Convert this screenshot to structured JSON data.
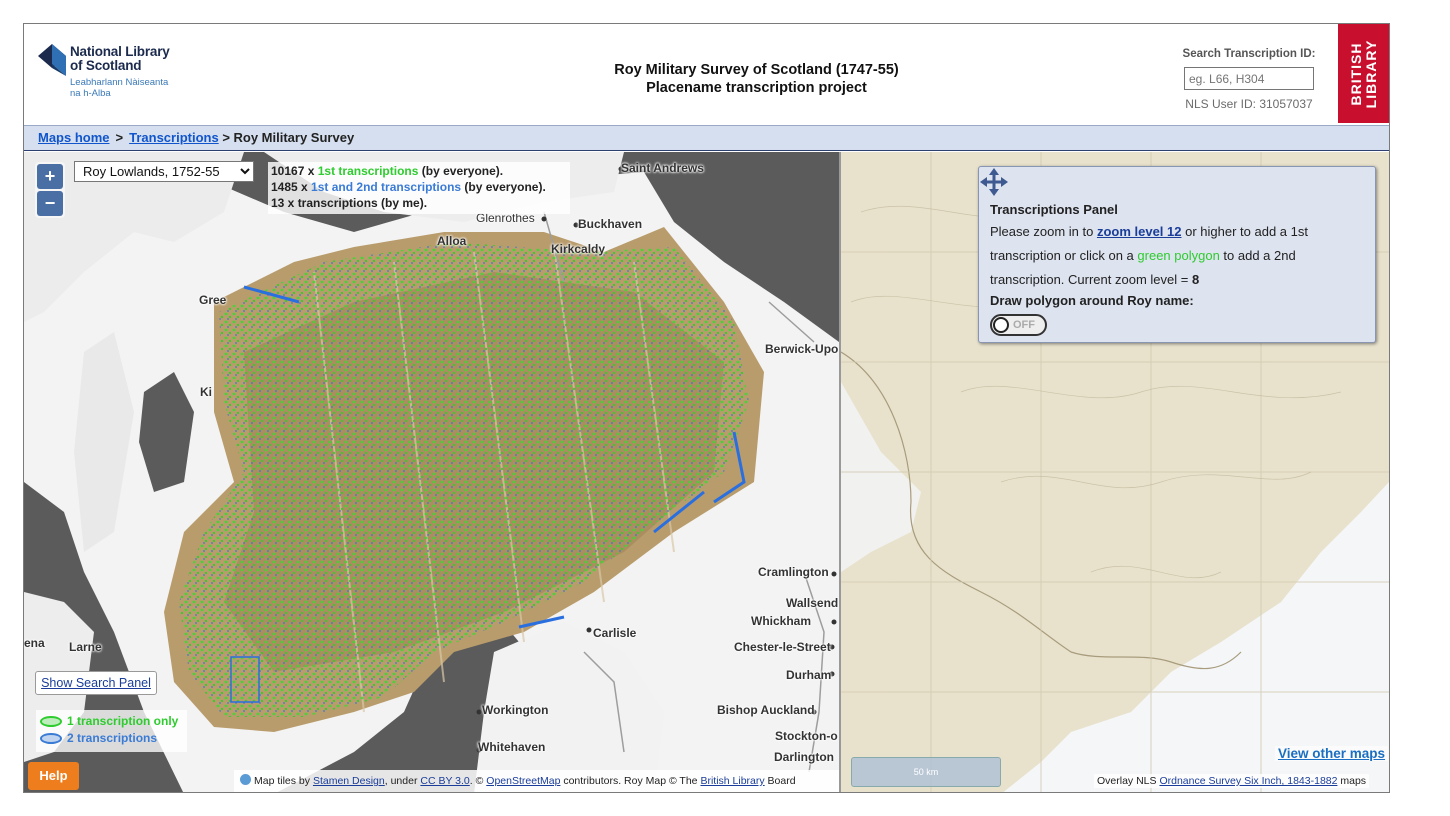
{
  "header": {
    "nls_name_line1": "National Library",
    "nls_name_line2": "of Scotland",
    "nls_gaelic_line1": "Leabharlann Nàiseanta",
    "nls_gaelic_line2": "na h-Alba",
    "title_line1": "Roy Military Survey of Scotland (1747-55)",
    "title_line2": "Placename transcription project",
    "search_label": "Search Transcription ID:",
    "search_placeholder": "eg. L66, H304",
    "user_id": "NLS User ID: 31057037",
    "bl_line1": "BRITISH",
    "bl_line2": "LIBRARY"
  },
  "breadcrumb": {
    "maps_home": "Maps home",
    "sep": ">",
    "transcriptions": "Transcriptions",
    "current": "> Roy Military Survey"
  },
  "left_map": {
    "zoom_in": "+",
    "zoom_out": "−",
    "layer_selected": "Roy Lowlands, 1752-55",
    "stats": {
      "line1_pre": "10167 x ",
      "line1_mid": "1st transcriptions",
      "line1_post": " (by everyone).",
      "line2_pre": "1485 x ",
      "line2_mid": "1st and 2nd transcriptions",
      "line2_post": " (by everyone).",
      "line3": "13 x transcriptions (by me)."
    },
    "places": {
      "saint_andrews": "Saint Andrews",
      "glenrothes": "Glenrothes",
      "buckhaven": "Buckhaven",
      "kirkcaldy": "Kirkcaldy",
      "alloa": "Alloa",
      "greenock": "Gree",
      "kilmarnock": "Ki",
      "berwick": "Berwick-Upo",
      "cramlington": "Cramlington",
      "wallsend": "Wallsend",
      "whickham": "Whickham",
      "chester": "Chester-le-Street",
      "durham": "Durham",
      "bishop": "Bishop Auckland",
      "stockton": "Stockton-o",
      "darlington": "Darlington",
      "carlisle": "Carlisle",
      "workington": "Workington",
      "whitehaven": "Whitehaven",
      "larne": "Larne",
      "lena": "ena"
    },
    "show_search": "Show Search Panel",
    "legend_1": "1 transcription only",
    "legend_2": "2 transcriptions",
    "help": "Help",
    "attr": {
      "t1": "Map tiles by ",
      "stamen": "Stamen Design",
      "t2": ", under ",
      "ccby": "CC BY 3.0",
      "t3": ". © ",
      "osm": "OpenStreetMap",
      "t4": " contributors. Roy Map © The ",
      "bl": "British Library",
      "t5": " Board"
    }
  },
  "panel": {
    "title": "Transcriptions Panel",
    "t1": "Please zoom in to ",
    "zoom_link": "zoom level 12",
    "t2": " or higher to add a 1st transcription or click on a ",
    "green_polygon": "green polygon",
    "t3": " to add a 2nd transcription. Current zoom level = ",
    "zoom_level": "8",
    "draw_label": "Draw polygon around Roy name:",
    "toggle": "OFF"
  },
  "right_map": {
    "view_other": "View other maps",
    "scale": "50 km",
    "attr_pre": "Overlay NLS ",
    "attr_link": "Ordnance Survey Six Inch, 1843-1882",
    "attr_post": " maps"
  },
  "colors": {
    "accent_green": "#2ecc2e",
    "accent_blue": "#3a7bd5",
    "bl_red": "#c8102e",
    "help_orange": "#ee7d1e"
  }
}
